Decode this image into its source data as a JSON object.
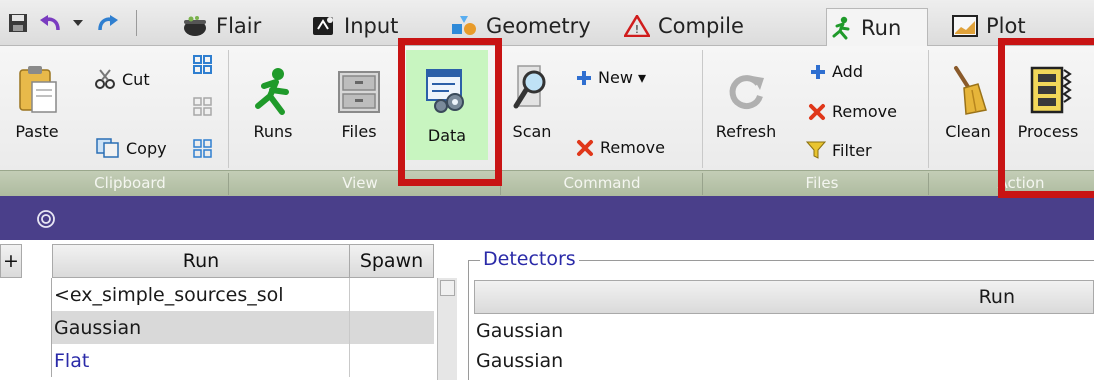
{
  "tabs": [
    {
      "label": "Flair",
      "icon": "cauldron-icon"
    },
    {
      "label": "Input",
      "icon": "input-icon"
    },
    {
      "label": "Geometry",
      "icon": "geometry-icon"
    },
    {
      "label": "Compile",
      "icon": "warning-triangle-icon"
    },
    {
      "label": "Run",
      "icon": "running-man-icon",
      "active": true
    },
    {
      "label": "Plot",
      "icon": "plot-icon"
    }
  ],
  "ribbon": {
    "clipboard": {
      "paste": "Paste",
      "cut": "Cut",
      "copy": "Copy",
      "group": "Clipboard"
    },
    "view": {
      "runs": "Runs",
      "files": "Files",
      "data": "Data",
      "group": "View"
    },
    "command": {
      "scan": "Scan",
      "new": "New ▾",
      "remove": "Remove",
      "group": "Command"
    },
    "files": {
      "refresh": "Refresh",
      "add": "Add",
      "remove": "Remove",
      "filter": "Filter",
      "group": "Files"
    },
    "action": {
      "clean": "Clean",
      "process": "Process",
      "group": "Action"
    }
  },
  "run_table": {
    "corner": "+",
    "headers": [
      "Run",
      "Spawn"
    ],
    "rows": [
      {
        "run": "<ex_simple_sources_sol",
        "spawn": ""
      },
      {
        "run": "Gaussian",
        "spawn": ""
      },
      {
        "run": "Flat",
        "spawn": ""
      }
    ]
  },
  "detectors": {
    "title": "Detectors",
    "header": "Run",
    "rows": [
      "Gaussian",
      "Gaussian"
    ]
  },
  "colors": {
    "accent_purple": "#4a3f8a",
    "highlight_red": "#c81414",
    "selected_green": "#c8f5c0",
    "group_strip": "#b7c3aa"
  }
}
